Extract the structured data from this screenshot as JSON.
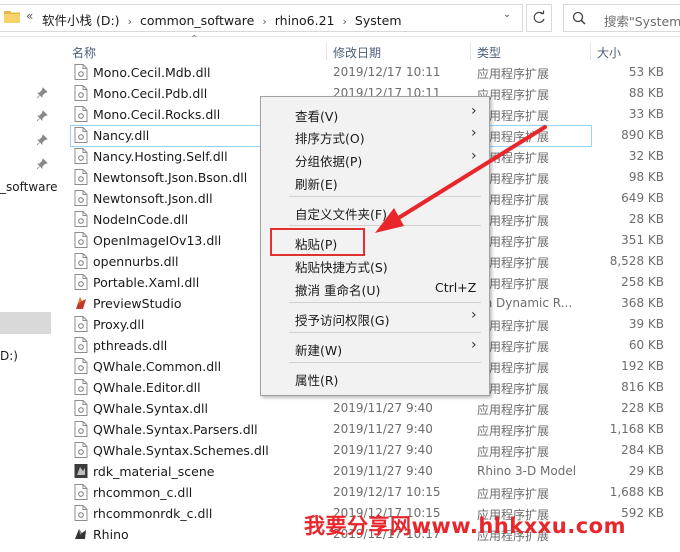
{
  "address": {
    "lead": "«",
    "crumbs": [
      "软件小栈 (D:)",
      "common_software",
      "rhino6.21",
      "System"
    ],
    "separator": "›"
  },
  "search": {
    "placeholder": "搜索\"System\""
  },
  "nav": {
    "label_software": "_software",
    "label_drive": "D:)"
  },
  "columns": {
    "name": "名称",
    "date": "修改日期",
    "type": "类型",
    "size": "大小"
  },
  "files": [
    {
      "name": "Mono.Cecil.Mdb.dll",
      "date": "2019/12/17 10:11",
      "type": "应用程序扩展",
      "size": "53 KB",
      "icon": "dll-icon"
    },
    {
      "name": "Mono.Cecil.Pdb.dll",
      "date": "2019/12/17 10:11",
      "type": "应用程序扩展",
      "size": "88 KB",
      "icon": "dll-icon"
    },
    {
      "name": "Mono.Cecil.Rocks.dll",
      "date": "",
      "type": "应用程序扩展",
      "size": "33 KB",
      "icon": "dll-icon"
    },
    {
      "name": "Nancy.dll",
      "date": "",
      "type": "应用程序扩展",
      "size": "890 KB",
      "icon": "dll-icon",
      "selected": true
    },
    {
      "name": "Nancy.Hosting.Self.dll",
      "date": "",
      "type": "应用程序扩展",
      "size": "32 KB",
      "icon": "dll-icon"
    },
    {
      "name": "Newtonsoft.Json.Bson.dll",
      "date": "",
      "type": "应用程序扩展",
      "size": "98 KB",
      "icon": "dll-icon"
    },
    {
      "name": "Newtonsoft.Json.dll",
      "date": "",
      "type": "应用程序扩展",
      "size": "649 KB",
      "icon": "dll-icon"
    },
    {
      "name": "NodeInCode.dll",
      "date": "",
      "type": "应用程序扩展",
      "size": "28 KB",
      "icon": "dll-icon"
    },
    {
      "name": "OpenImageIOv13.dll",
      "date": "",
      "type": "应用程序扩展",
      "size": "351 KB",
      "icon": "dll-icon"
    },
    {
      "name": "opennurbs.dll",
      "date": "",
      "type": "应用程序扩展",
      "size": "8,528 KB",
      "icon": "dll-icon"
    },
    {
      "name": "Portable.Xaml.dll",
      "date": "",
      "type": "应用程序扩展",
      "size": "258 KB",
      "icon": "dll-icon"
    },
    {
      "name": "PreviewStudio",
      "date": "",
      "type": "gh Dynamic R...",
      "size": "368 KB",
      "icon": "preview-studio-icon"
    },
    {
      "name": "Proxy.dll",
      "date": "",
      "type": "应用程序扩展",
      "size": "39 KB",
      "icon": "dll-icon"
    },
    {
      "name": "pthreads.dll",
      "date": "",
      "type": "应用程序扩展",
      "size": "60 KB",
      "icon": "dll-icon"
    },
    {
      "name": "QWhale.Common.dll",
      "date": "",
      "type": "应用程序扩展",
      "size": "192 KB",
      "icon": "dll-icon"
    },
    {
      "name": "QWhale.Editor.dll",
      "date": "",
      "type": "应用程序扩展",
      "size": "816 KB",
      "icon": "dll-icon"
    },
    {
      "name": "QWhale.Syntax.dll",
      "date": "2019/11/27 9:40",
      "type": "应用程序扩展",
      "size": "228 KB",
      "icon": "dll-icon"
    },
    {
      "name": "QWhale.Syntax.Parsers.dll",
      "date": "2019/11/27 9:40",
      "type": "应用程序扩展",
      "size": "1,168 KB",
      "icon": "dll-icon"
    },
    {
      "name": "QWhale.Syntax.Schemes.dll",
      "date": "2019/11/27 9:40",
      "type": "应用程序扩展",
      "size": "284 KB",
      "icon": "dll-icon"
    },
    {
      "name": "rdk_material_scene",
      "date": "2019/11/27 9:40",
      "type": "Rhino 3-D Model",
      "size": "29 KB",
      "icon": "rhino-model-icon"
    },
    {
      "name": "rhcommon_c.dll",
      "date": "2019/12/17 10:15",
      "type": "应用程序扩展",
      "size": "1,688 KB",
      "icon": "dll-icon"
    },
    {
      "name": "rhcommonrdk_c.dll",
      "date": "2019/12/17 10:15",
      "type": "应用程序扩展",
      "size": "592 KB",
      "icon": "dll-icon"
    },
    {
      "name": "Rhino",
      "date": "2019/12/17 10:17",
      "type": "应用程序扩展",
      "size": "",
      "icon": "rhino-icon"
    }
  ],
  "context_menu": {
    "view": "查看(V)",
    "sort": "排序方式(O)",
    "group": "分组依据(P)",
    "refresh": "刷新(E)",
    "customize": "自定义文件夹(F)...",
    "paste": "粘贴(P)",
    "paste_shortcut": "粘贴快捷方式(S)",
    "undo_rename": "撤消 重命名(U)",
    "undo_shortcut": "Ctrl+Z",
    "grant_access": "授予访问权限(G)",
    "new": "新建(W)",
    "properties": "属性(R)"
  },
  "watermark": "我要分享网www.hhkxxu.com",
  "colors": {
    "annotation_red": "#e8262b",
    "selection_border": "#99d1ff"
  }
}
